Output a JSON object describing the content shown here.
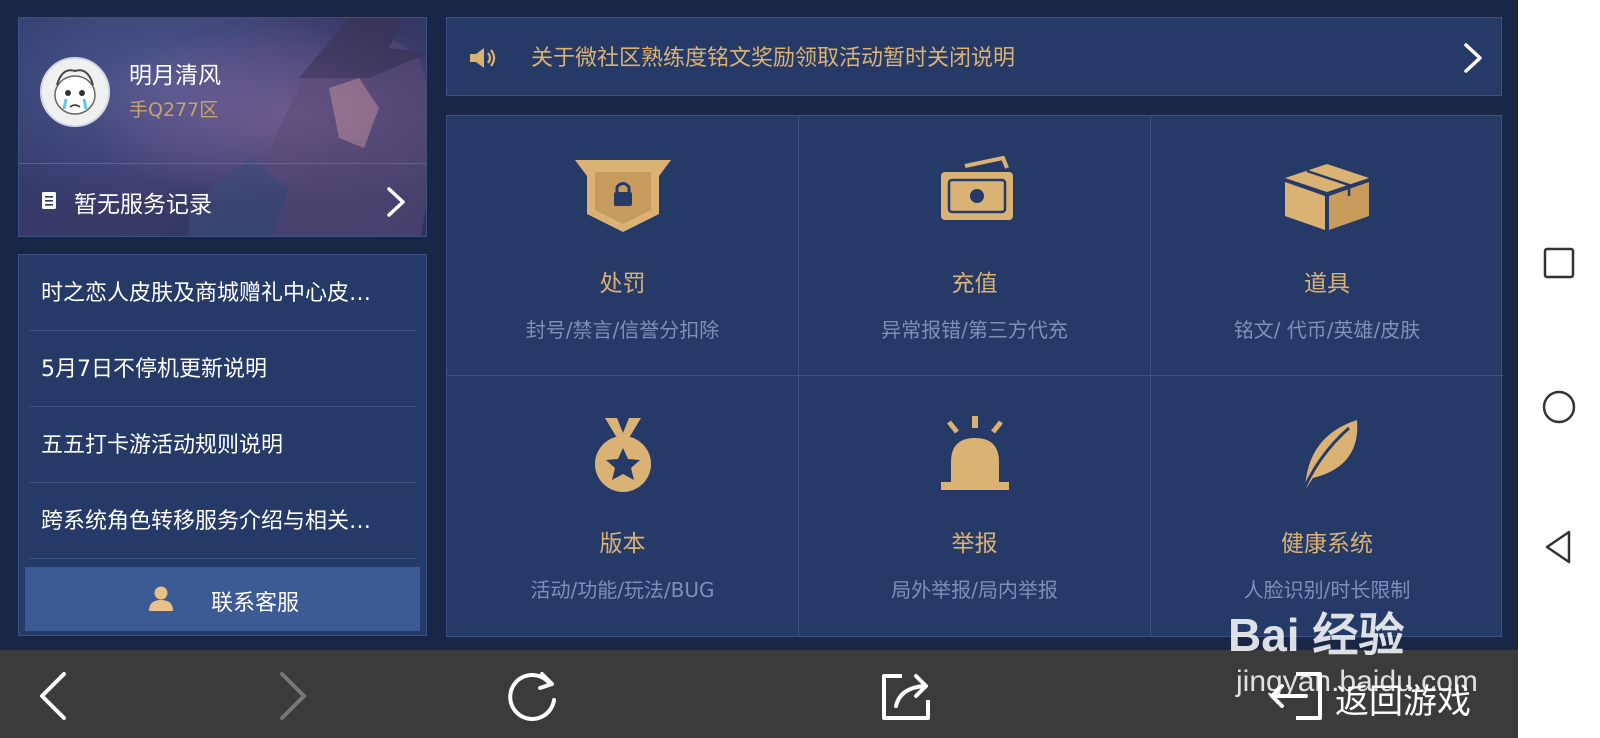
{
  "profile": {
    "name": "明月清风",
    "server": "手Q277区",
    "service_record": "暂无服务记录"
  },
  "news": [
    "时之恋人皮肤及商城赠礼中心皮…",
    "5月7日不停机更新说明",
    "五五打卡游活动规则说明",
    "跨系统角色转移服务介绍与相关…"
  ],
  "contact_label": "联系客服",
  "notice": "关于微社区熟练度铭文奖励领取活动暂时关闭说明",
  "categories": [
    {
      "title": "处罚",
      "sub": "封号/禁言/信誉分扣除",
      "icon": "shield-lock-icon"
    },
    {
      "title": "充值",
      "sub": "异常报错/第三方代充",
      "icon": "money-icon"
    },
    {
      "title": "道具",
      "sub": "铭文/ 代币/英雄/皮肤",
      "icon": "box-icon"
    },
    {
      "title": "版本",
      "sub": "活动/功能/玩法/BUG",
      "icon": "medal-icon"
    },
    {
      "title": "举报",
      "sub": "局外举报/局内举报",
      "icon": "alarm-icon"
    },
    {
      "title": "健康系统",
      "sub": "人脸识别/时长限制",
      "icon": "leaf-icon"
    }
  ],
  "bottom_bar": {
    "return_label": "返回游戏"
  },
  "watermark": {
    "brand": "Bai 经验",
    "url": "jingyan.baidu.com"
  },
  "colors": {
    "accent_gold": "#d9b274",
    "panel": "#263a68",
    "background": "#1a2646"
  }
}
